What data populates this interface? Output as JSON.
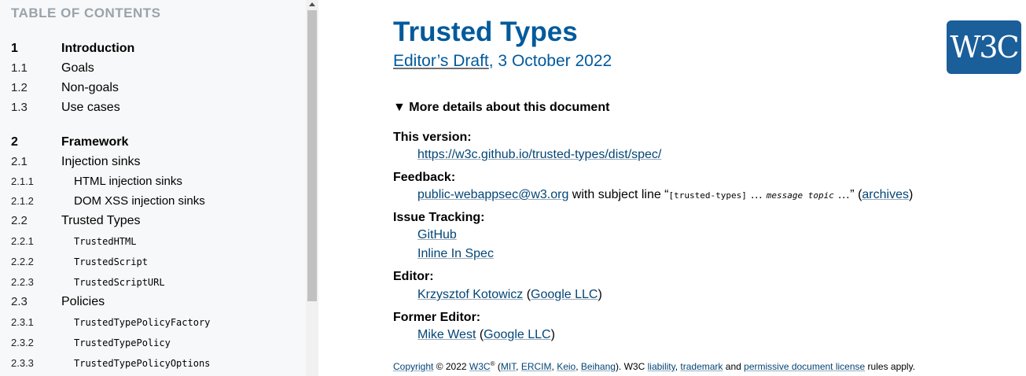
{
  "toc": {
    "heading": "TABLE OF CONTENTS",
    "items": [
      {
        "num": "1",
        "text": "Introduction"
      },
      {
        "num": "1.1",
        "text": "Goals"
      },
      {
        "num": "1.2",
        "text": "Non-goals"
      },
      {
        "num": "1.3",
        "text": "Use cases"
      },
      {
        "num": "2",
        "text": "Framework"
      },
      {
        "num": "2.1",
        "text": "Injection sinks"
      },
      {
        "num": "2.1.1",
        "text": "HTML injection sinks"
      },
      {
        "num": "2.1.2",
        "text": "DOM XSS injection sinks"
      },
      {
        "num": "2.2",
        "text": "Trusted Types"
      },
      {
        "num": "2.2.1",
        "text": "TrustedHTML"
      },
      {
        "num": "2.2.2",
        "text": "TrustedScript"
      },
      {
        "num": "2.2.3",
        "text": "TrustedScriptURL"
      },
      {
        "num": "2.3",
        "text": "Policies"
      },
      {
        "num": "2.3.1",
        "text": "TrustedTypePolicyFactory"
      },
      {
        "num": "2.3.2",
        "text": "TrustedTypePolicy"
      },
      {
        "num": "2.3.3",
        "text": "TrustedTypePolicyOptions"
      }
    ]
  },
  "header": {
    "title": "Trusted Types",
    "status_link": "Editor’s Draft",
    "date": ", 3 October 2022",
    "logo_text": "W3C",
    "colors": {
      "accent": "#005a9c",
      "logo_bg": "#1a5e9a"
    }
  },
  "details": {
    "summary": "▼ More details about this document",
    "this_version_label": "This version:",
    "this_version_url": "https://w3c.github.io/trusted-types/dist/spec/",
    "feedback_label": "Feedback:",
    "feedback_email": "public-webappsec@w3.org",
    "feedback_text1": " with subject line “",
    "feedback_code": "[trusted-types]",
    "feedback_ellipsis1": " … ",
    "feedback_topic": "message topic",
    "feedback_ellipsis2": " …",
    "feedback_text2": "” (",
    "feedback_archives": "archives",
    "feedback_close": ")",
    "issue_label": "Issue Tracking:",
    "issue_github": "GitHub",
    "issue_inline": "Inline In Spec",
    "editor_label": "Editor:",
    "editor_name": "Krzysztof Kotowicz",
    "editor_org": "Google LLC",
    "former_label": "Former Editor:",
    "former_name": "Mike West",
    "former_org": "Google LLC"
  },
  "copyright": {
    "copyright_link": "Copyright",
    "year": " © 2022 ",
    "w3c": "W3C",
    "reg": "®",
    "open": " (",
    "mit": "MIT",
    "ercim": "ERCIM",
    "keio": "Keio",
    "beihang": "Beihang",
    "after_hosts": "). W3C ",
    "liability": "liability",
    "trademark": "trademark",
    "and": " and ",
    "license": "permissive document license",
    "rules": " rules apply."
  }
}
